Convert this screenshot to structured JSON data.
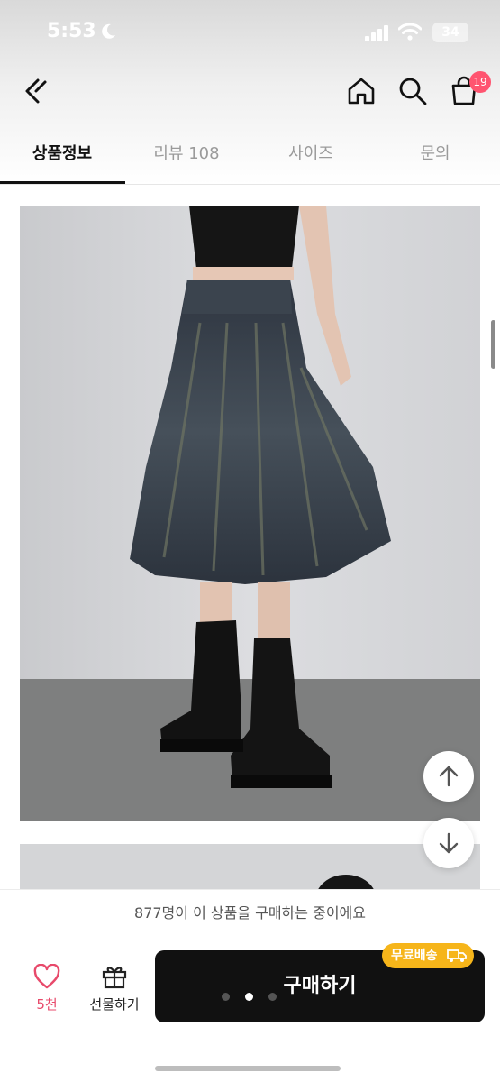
{
  "status_bar": {
    "time": "5:53",
    "battery": "34"
  },
  "nav": {
    "cart_count": "19"
  },
  "tabs": [
    {
      "label": "상품정보"
    },
    {
      "label": "리뷰 108"
    },
    {
      "label": "사이즈"
    },
    {
      "label": "문의"
    }
  ],
  "notice": "877명이 이 상품을 구매하는 중이에요",
  "actions": {
    "like_count": "5천",
    "gift_label": "선물하기",
    "buy_label": "구매하기",
    "shipping_badge": "무료배송"
  },
  "carousel": {
    "dot_count": 3,
    "active_dot": 2
  },
  "colors": {
    "accent": "#e84a6b",
    "badge": "#ff5470",
    "shipping": "#f6b51a",
    "button": "#111111"
  },
  "icons": [
    "moon-icon",
    "signal-icon",
    "wifi-icon",
    "back-icon",
    "home-icon",
    "search-icon",
    "cart-icon",
    "arrow-up-icon",
    "arrow-down-icon",
    "heart-icon",
    "gift-icon",
    "truck-icon"
  ]
}
